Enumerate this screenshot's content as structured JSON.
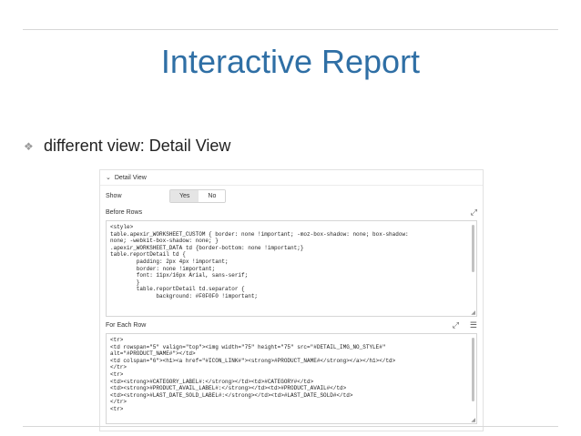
{
  "slide": {
    "title": "Interactive Report",
    "bullet_icon": "diamond-bullet-icon",
    "bullet_text": "different view: Detail View"
  },
  "panel": {
    "header": "Detail View",
    "show_label": "Show",
    "toggle_yes": "Yes",
    "toggle_no": "No",
    "before_rows_label": "Before Rows",
    "for_each_row_label": "For Each Row",
    "before_rows_code": "<style>\ntable.apexir_WORKSHEET_CUSTOM { border: none !important; -moz-box-shadow: none; box-shadow:\nnone; -webkit-box-shadow: none; }\n.apexir_WORKSHEET_DATA td {border-bottom: none !important;}\ntable.reportDetail td {\n        padding: 2px 4px !important;\n        border: none !important;\n        font: 11px/16px Arial, sans-serif;\n        }\n        table.reportDetail td.separator {\n              background: #F0F0F0 !important;",
    "for_each_row_code": "<tr>\n<td rowspan=\"5\" valign=\"top\"><img width=\"75\" height=\"75\" src=\"#DETAIL_IMG_NO_STYLE#\"\nalt=\"#PRODUCT_NAME#\"></td>\n<td colspan=\"6\"><h1><a href=\"#ICON_LINK#\"><strong>#PRODUCT_NAME#</strong></a></h1></td>\n</tr>\n<tr>\n<td><strong>#CATEGORY_LABEL#:</strong></td><td>#CATEGORY#</td>\n<td><strong>#PRODUCT_AVAIL_LABEL#:</strong></td><td>#PRODUCT_AVAIL#</td>\n<td><strong>#LAST_DATE_SOLD_LABEL#:</strong></td><td>#LAST_DATE_SOLD#</td>\n</tr>\n<tr>"
  }
}
